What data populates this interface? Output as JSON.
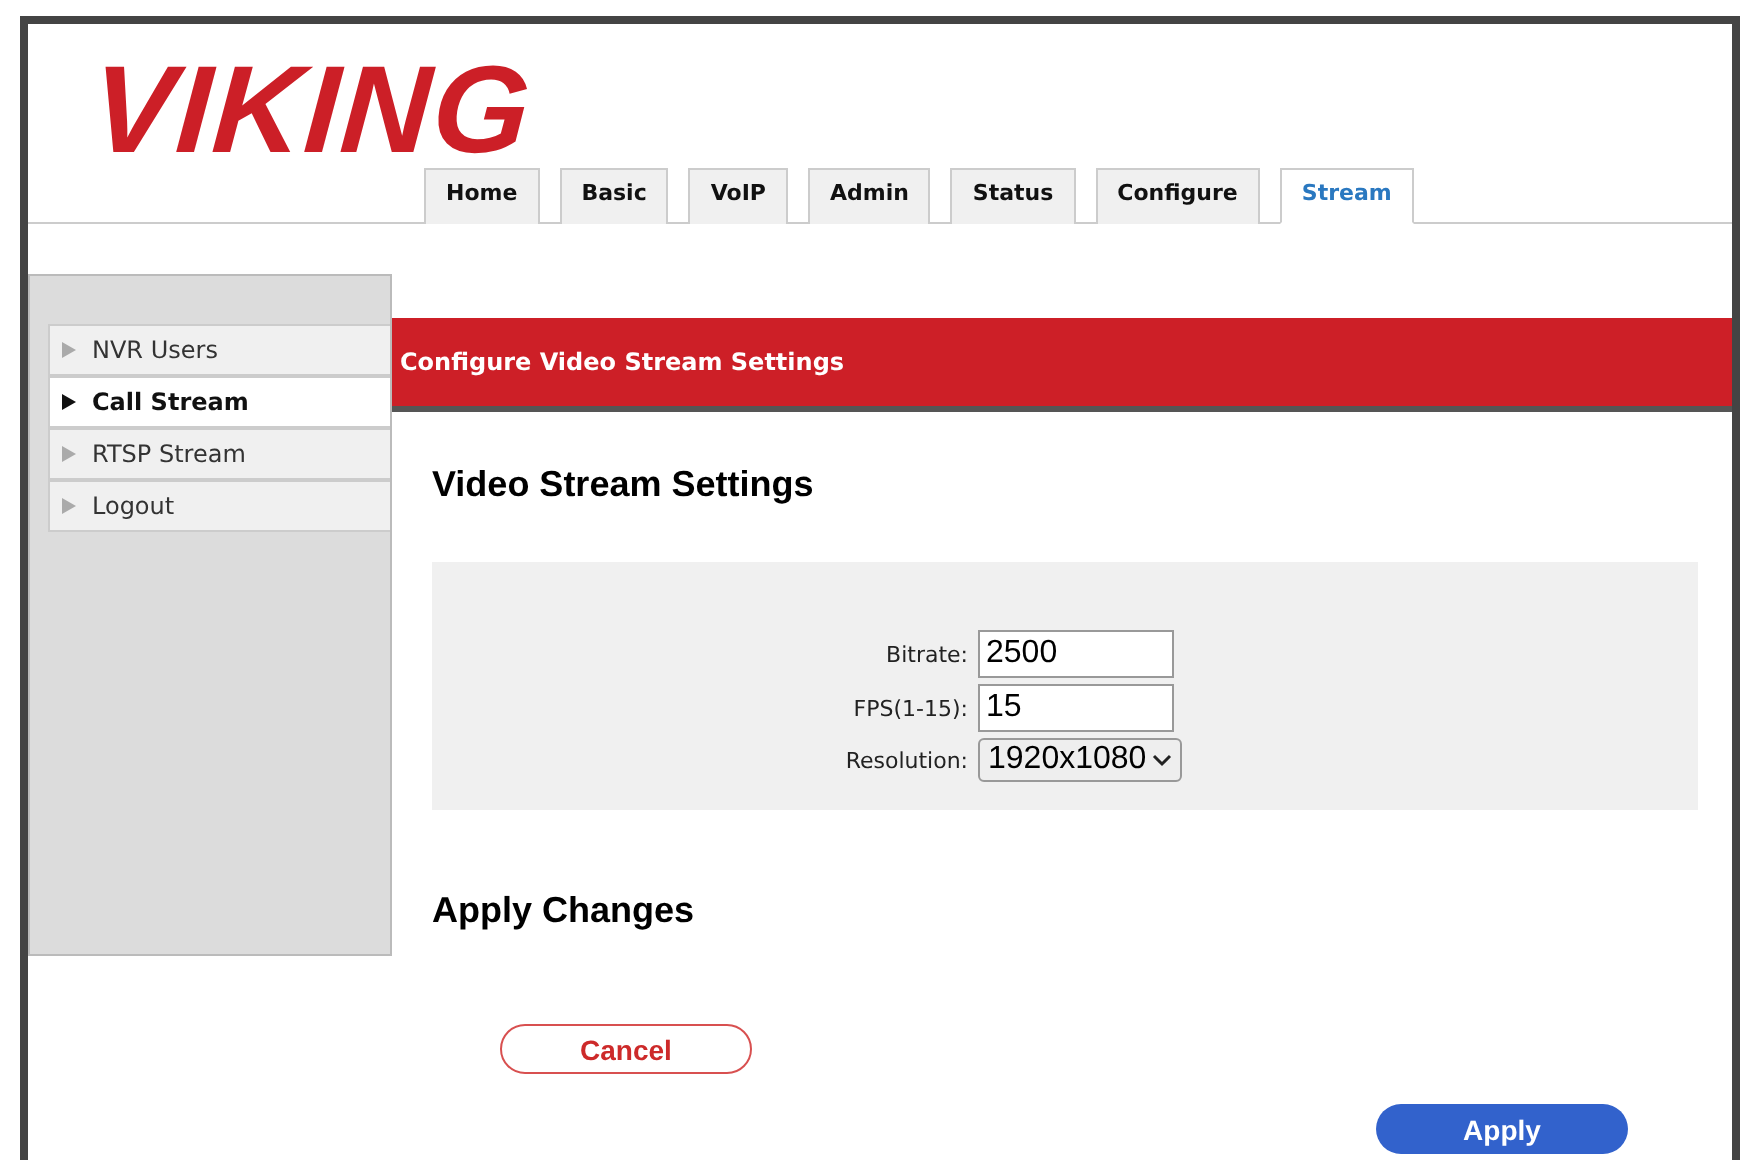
{
  "logo": "VIKING",
  "tabs": [
    {
      "label": "Home",
      "selected": false
    },
    {
      "label": "Basic",
      "selected": false
    },
    {
      "label": "VoIP",
      "selected": false
    },
    {
      "label": "Admin",
      "selected": false
    },
    {
      "label": "Status",
      "selected": false
    },
    {
      "label": "Configure",
      "selected": false
    },
    {
      "label": "Stream",
      "selected": true
    }
  ],
  "sidebar": {
    "items": [
      {
        "label": "NVR Users",
        "selected": false
      },
      {
        "label": "Call Stream",
        "selected": true
      },
      {
        "label": "RTSP Stream",
        "selected": false
      },
      {
        "label": "Logout",
        "selected": false
      }
    ]
  },
  "header": "Configure Video Stream Settings",
  "section_title": "Video Stream Settings",
  "fields": [
    {
      "kind": "text",
      "label": "Bitrate:",
      "value": "2500"
    },
    {
      "kind": "text",
      "label": "FPS(1-15):",
      "value": "15"
    },
    {
      "kind": "select",
      "label": "Resolution:",
      "value": "1920x1080"
    }
  ],
  "apply_title": "Apply Changes",
  "buttons": [
    {
      "kind": "cancel",
      "label": "Cancel"
    },
    {
      "kind": "apply",
      "label": "Apply"
    }
  ]
}
